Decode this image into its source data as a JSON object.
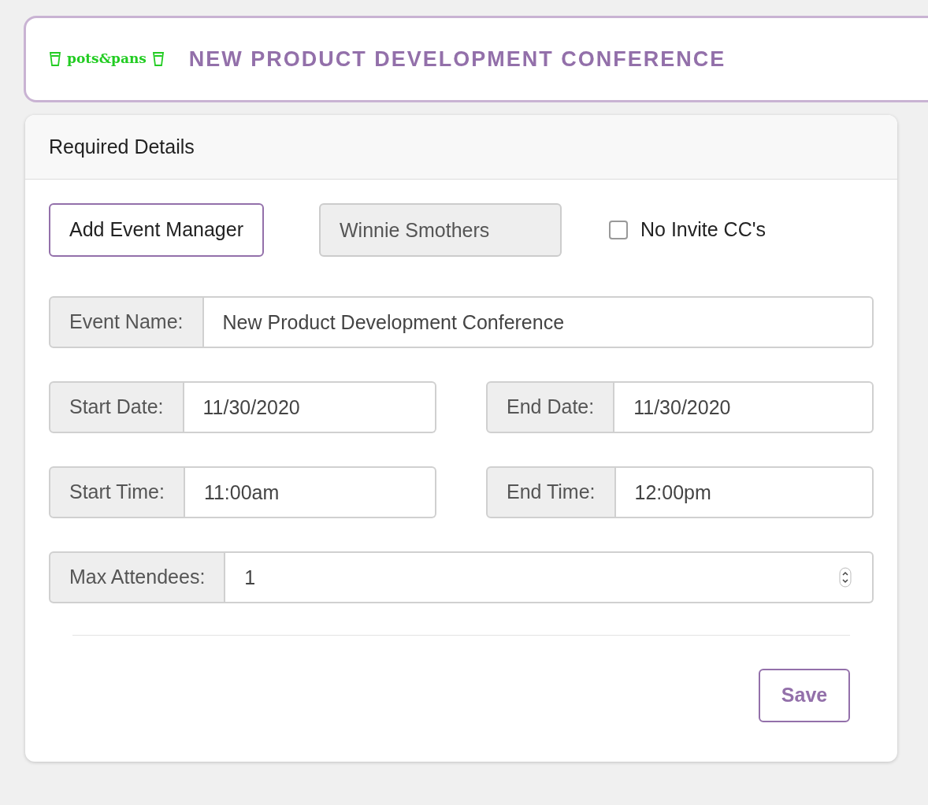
{
  "header": {
    "logo": "pots&pans",
    "title": "NEW PRODUCT DEVELOPMENT CONFERENCE"
  },
  "card": {
    "title": "Required Details",
    "manager_button": "Add Event Manager",
    "manager_field": {
      "value": "Winnie Smothers",
      "disabled": true
    },
    "no_invite_cc": {
      "label": "No Invite CC's",
      "checked": false
    },
    "fields": [
      {
        "label": "Event Name:",
        "value": "New Product Development Conference",
        "kind": "text"
      },
      {
        "label": "Start Date:",
        "value": "11/30/2020",
        "kind": "text"
      },
      {
        "label": "End Date:",
        "value": "11/30/2020",
        "kind": "text"
      },
      {
        "label": "Start Time:",
        "value": "11:00am",
        "kind": "text"
      },
      {
        "label": "End Time:",
        "value": "12:00pm",
        "kind": "text"
      },
      {
        "label": "Max Attendees:",
        "value": "1",
        "kind": "number"
      }
    ],
    "save_button": "Save"
  }
}
